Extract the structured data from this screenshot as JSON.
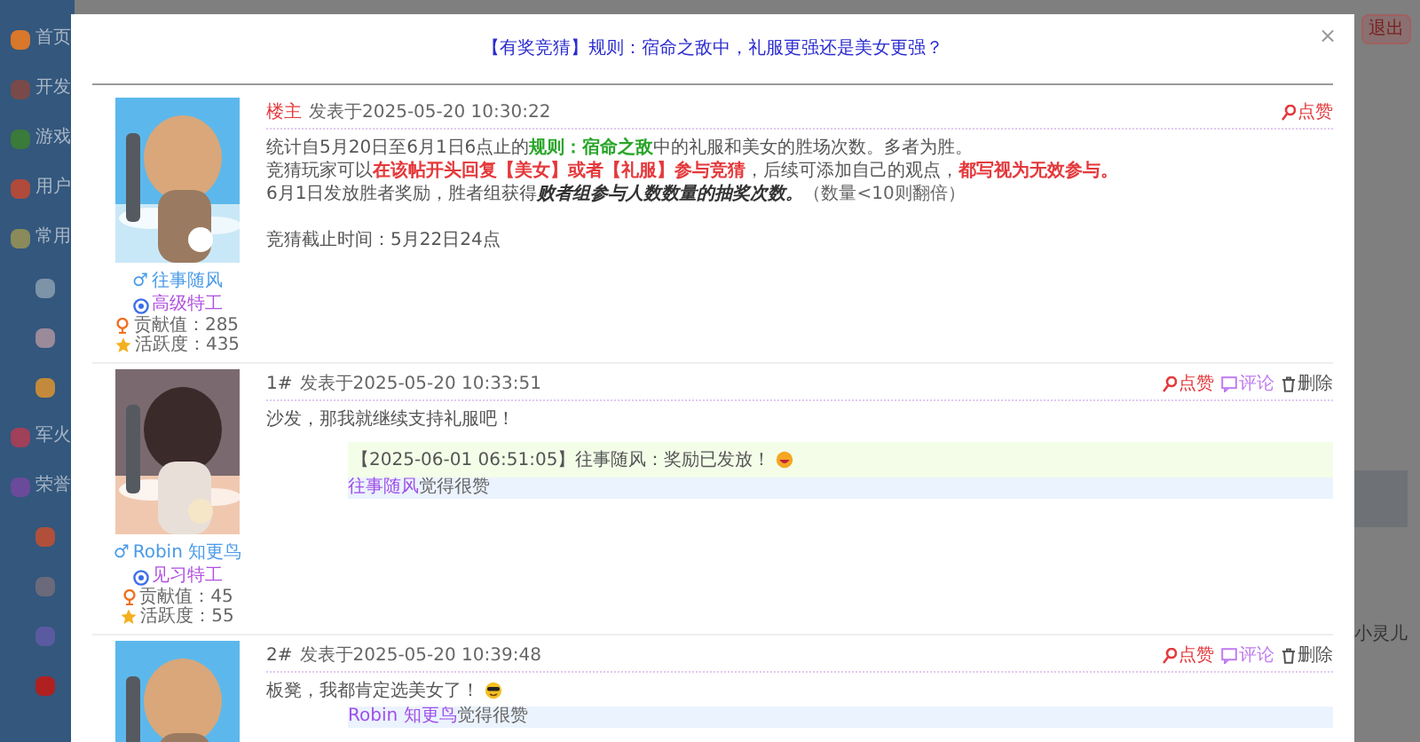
{
  "sidebar": {
    "items": [
      {
        "label": "首页",
        "color": "#d9772b"
      },
      {
        "label": "开发",
        "color": "#7a4a4a"
      },
      {
        "label": "游戏",
        "color": "#3a7a3a"
      },
      {
        "label": "用户",
        "color": "#b04a3a"
      },
      {
        "label": "常用",
        "color": "#8a8a5a",
        "children": [
          {
            "kind": "icon",
            "color": "#7d93a8"
          },
          {
            "kind": "icon",
            "color": "#9a8a9a"
          },
          {
            "kind": "icon",
            "color": "#c28a3a"
          }
        ]
      },
      {
        "label": "军火",
        "color": "#a0405a"
      },
      {
        "label": "荣誉",
        "color": "#6a4a9a",
        "children": [
          {
            "kind": "icon",
            "color": "#b0503a"
          },
          {
            "kind": "icon",
            "color": "#6a6a7a"
          },
          {
            "kind": "icon",
            "color": "#5a5aa0"
          },
          {
            "kind": "icon",
            "color": "#b02020"
          }
        ]
      }
    ]
  },
  "header": {
    "logout": "退出"
  },
  "background_text": "小灵儿",
  "dialog": {
    "title": "【有奖竞猜】规则：宿命之敌中，礼服更强还是美女更强？",
    "close": "×",
    "posts": [
      {
        "floor": "楼主",
        "owner": true,
        "date": "发表于2025-05-20 10:30:22",
        "avatar": {
          "kind": "picture"
        },
        "user": {
          "gender": "♂",
          "name": "往事随风",
          "rank": "高级特工",
          "contribution": "贡献值：285",
          "activity": "活跃度：435"
        },
        "actions": [
          {
            "kind": "like",
            "label": "点赞"
          }
        ],
        "content": [
          {
            "spans": [
              {
                "kind": "plain",
                "text": "统计自5月20日至6月1日6点止的"
              },
              {
                "kind": "green",
                "text": "规则：宿命之敌"
              },
              {
                "kind": "plain",
                "text": "中的礼服和美女的胜场次数。多者为胜。"
              }
            ]
          },
          {
            "spans": [
              {
                "kind": "plain",
                "text": "竞猜玩家可以"
              },
              {
                "kind": "red",
                "text": "在该帖开头回复【美女】或者【礼服】参与竞猜"
              },
              {
                "kind": "plain",
                "text": "，后续可添加自己的观点，"
              },
              {
                "kind": "red",
                "text": "都写视为无效参与。"
              }
            ]
          },
          {
            "spans": [
              {
                "kind": "plain",
                "text": "6月1日发放胜者奖励，胜者组获得"
              },
              {
                "kind": "emph",
                "text": "败者组参与人数数量的抽奖次数。"
              },
              {
                "kind": "small",
                "text": "（数量<10则翻倍）"
              }
            ]
          }
        ],
        "deadline": "竞猜截止时间：5月22日24点"
      },
      {
        "floor": "1#",
        "owner": false,
        "date": "发表于2025-05-20 10:33:51",
        "avatar": {
          "kind": "picture"
        },
        "user": {
          "gender": "♂",
          "name": "Robin 知更鸟",
          "rank": "见习特工",
          "contribution": "贡献值：45",
          "activity": "活跃度：55"
        },
        "actions": [
          {
            "kind": "like",
            "label": "点赞"
          },
          {
            "kind": "comment",
            "label": "评论"
          },
          {
            "kind": "delete",
            "label": "删除"
          }
        ],
        "content": [
          {
            "spans": [
              {
                "kind": "plain",
                "text": "沙发，那我就继续支持礼服吧！"
              }
            ]
          }
        ],
        "comments": [
          {
            "text": "【2025-06-01 06:51:05】往事随风：奖励已发放！",
            "emoji": true
          }
        ],
        "liked_by": [
          {
            "name": "往事随风",
            "suffix": "觉得很赞"
          }
        ]
      },
      {
        "floor": "2#",
        "owner": false,
        "date": "发表于2025-05-20 10:39:48",
        "avatar": {
          "kind": "picture"
        },
        "actions": [
          {
            "kind": "like",
            "label": "点赞"
          },
          {
            "kind": "comment",
            "label": "评论"
          },
          {
            "kind": "delete",
            "label": "删除"
          }
        ],
        "content": [
          {
            "spans": [
              {
                "kind": "plain",
                "text": "板凳，我都肯定选美女了！"
              },
              {
                "kind": "emoji"
              }
            ]
          }
        ],
        "liked_by": [
          {
            "name": "Robin 知更鸟",
            "suffix": "觉得很赞"
          }
        ]
      }
    ]
  }
}
